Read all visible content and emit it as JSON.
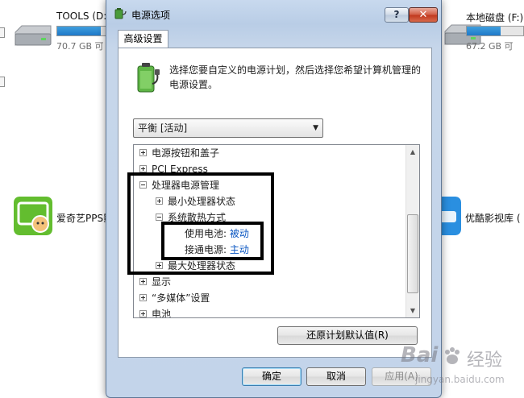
{
  "background": {
    "drives": [
      {
        "name": "TOOLS (D:",
        "size": "70.7 GB 可",
        "fill_percent": 90
      },
      {
        "name": "本地磁盘 (F:)",
        "size": "67.2 GB 可",
        "fill_percent": 60
      }
    ],
    "apps": [
      {
        "label": "爱奇艺PPS影",
        "icon": "iqiyi-app-icon"
      },
      {
        "label": "优酷影视库 (",
        "icon": "youku-app-icon"
      }
    ]
  },
  "dialog": {
    "title": "电源选项",
    "help_label": "?",
    "close_label": "✕",
    "tab": "高级设置",
    "description": "选择您要自定义的电源计划，然后选择您希望计算机管理的电源设置。",
    "plan_selected": "平衡 [活动]",
    "tree": {
      "power_buttons": "电源按钮和盖子",
      "pci_express": "PCI Express",
      "processor": "处理器电源管理",
      "min_state": "最小处理器状态",
      "cooling": "系统散热方式",
      "on_battery_label": "使用电池:",
      "on_battery_value": "被动",
      "plugged_in_label": "接通电源:",
      "plugged_in_value": "主动",
      "max_state": "最大处理器状态",
      "display": "显示",
      "multimedia": "“多媒体”设置",
      "battery": "电池"
    },
    "restore_button": "还原计划默认值(R)",
    "ok_button": "确定",
    "cancel_button": "取消",
    "apply_button": "应用(A)"
  },
  "watermark": {
    "brand": "Bai",
    "suffix": "经验",
    "url": "jingyan.baidu.com"
  },
  "colors": {
    "link": "#0b57c2",
    "accent": "#3c7fb1",
    "close": "#c13a20"
  }
}
